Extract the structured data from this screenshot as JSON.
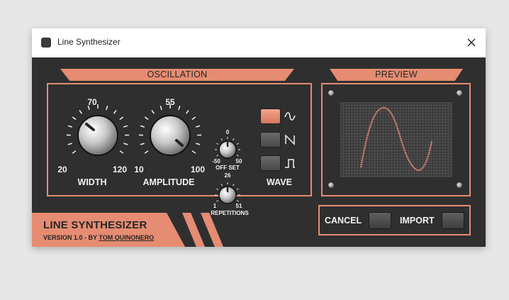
{
  "window": {
    "title": "Line Synthesizer"
  },
  "oscillation": {
    "banner": "OSCILLATION",
    "width": {
      "label": "WIDTH",
      "min": "20",
      "max": "120",
      "mid": "70"
    },
    "amplitude": {
      "label": "AMPLITUDE",
      "min": "10",
      "max": "100",
      "mid": "55"
    },
    "offset": {
      "label": "OFF SET",
      "min": "-50",
      "max": "50",
      "mid": "0"
    },
    "repetitions": {
      "label": "REPETITIONS",
      "min": "1",
      "max": "51",
      "mid": "26"
    },
    "wave": {
      "label": "WAVE",
      "options": [
        "sine",
        "sawtooth",
        "square"
      ],
      "selected": "sine"
    }
  },
  "preview": {
    "banner": "PREVIEW"
  },
  "footer": {
    "name": "LINE SYNTHESIZER",
    "version_prefix": "VERSION 1.0 - BY ",
    "author": "TOM QUINONERO"
  },
  "actions": {
    "cancel_label": "CANCEL",
    "import_label": "IMPORT"
  },
  "colors": {
    "accent": "#e58c72",
    "panel_bg": "#2f2f2f",
    "text": "#f2f2f2"
  }
}
